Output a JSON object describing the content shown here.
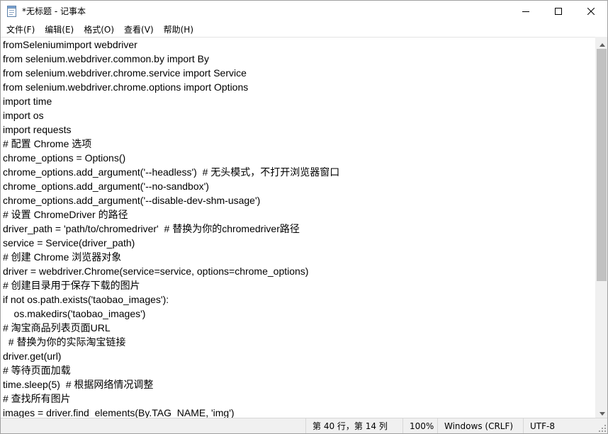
{
  "window": {
    "title": "*无标题 - 记事本"
  },
  "menu": {
    "items": [
      "文件(F)",
      "编辑(E)",
      "格式(O)",
      "查看(V)",
      "帮助(H)"
    ]
  },
  "editor": {
    "lines": [
      "fromSeleniumimport webdriver",
      "from selenium.webdriver.common.by import By",
      "from selenium.webdriver.chrome.service import Service",
      "from selenium.webdriver.chrome.options import Options",
      "import time",
      "import os",
      "import requests",
      "# 配置 Chrome 选项",
      "chrome_options = Options()",
      "chrome_options.add_argument('--headless')  # 无头模式，不打开浏览器窗口",
      "chrome_options.add_argument('--no-sandbox')",
      "chrome_options.add_argument('--disable-dev-shm-usage')",
      "# 设置 ChromeDriver 的路径",
      "driver_path = 'path/to/chromedriver'  # 替换为你的chromedriver路径",
      "service = Service(driver_path)",
      "# 创建 Chrome 浏览器对象",
      "driver = webdriver.Chrome(service=service, options=chrome_options)",
      "# 创建目录用于保存下载的图片",
      "if not os.path.exists('taobao_images'):",
      "    os.makedirs('taobao_images')",
      "# 淘宝商品列表页面URL",
      "  # 替换为你的实际淘宝链接",
      "driver.get(url)",
      "# 等待页面加载",
      "time.sleep(5)  # 根据网络情况调整",
      "# 查找所有图片",
      "images = driver.find_elements(By.TAG_NAME, 'img')"
    ]
  },
  "statusbar": {
    "position": "第 40 行，第 14 列",
    "zoom": "100%",
    "line_ending": "Windows (CRLF)",
    "encoding": "UTF-8"
  },
  "icons": {
    "app": "notepad-icon",
    "minimize": "minimize-icon",
    "maximize": "maximize-icon",
    "close": "close-icon"
  },
  "colors": {
    "scrollbar_thumb": "#c1c1c1",
    "statusbar_bg": "#f0f0f0"
  }
}
